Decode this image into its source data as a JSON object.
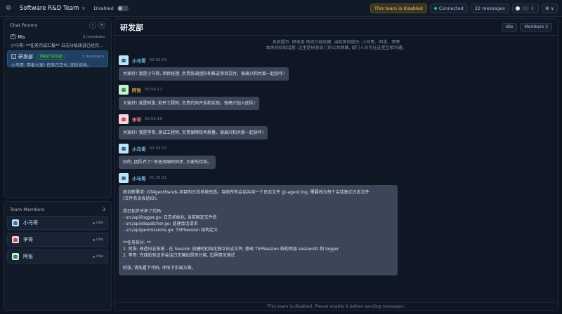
{
  "topbar": {
    "team_name": "Software R&D Team",
    "disabled_label": "Disabled",
    "warn_text": "This team is disabled",
    "connected_text": "Connected",
    "messages_text": "22 messages"
  },
  "rooms": {
    "title": "Chat Rooms",
    "items": [
      {
        "name": "Ma",
        "icon": "P",
        "count": "2 members",
        "preview": "小马哥: **任务完成汇报** 日志分级改进已经完成..."
      },
      {
        "name": "研发部",
        "icon": "□",
        "badge": "Dept Group",
        "count": "3 members",
        "preview": "小马哥: 李麦大家! 任务已交付, 团队待命。"
      }
    ]
  },
  "members": {
    "title": "Team Members",
    "count": "3",
    "items": [
      {
        "name": "小马哥",
        "status": "Idle"
      },
      {
        "name": "李哥",
        "status": "Idle"
      },
      {
        "name": "阿张",
        "status": "Idle"
      }
    ]
  },
  "chat": {
    "title": "研发部",
    "status_btn": "Idle",
    "members_btn": "Members 3",
    "system_line1": "系统提示: 研发部 房间已经创建, 当前房间成员: 小马哥、阿张、李哥",
    "system_line2": "本房间初始话题: 这里是研发部门的公共群聊, 部门人员可在这里互相沟通。",
    "messages": [
      {
        "name": "小马哥",
        "time": "00:56:04",
        "text": "大家好! 我是小马哥, 项目经理, 负责协调团队和推进项目交付。很高兴和大家一起协作!"
      },
      {
        "name": "阿张",
        "time": "00:56:12",
        "text": "大家好! 我是阿张, 软件工程师, 负责代码开发和实现。很高兴加入团队!"
      },
      {
        "name": "李哥",
        "time": "00:56:19",
        "text": "大家好! 我是李哥, 测试工程师, 负责保障软件质量。很高兴和大家一起协作!"
      },
      {
        "name": "小马哥",
        "time": "00:59:27",
        "text": "好的, 团队齐了! 有任务随时同步, 大家先待命。"
      },
      {
        "name": "小马哥",
        "time": "01:30:21",
        "lines": [
          "收到新需求: GTAgentHands 项目的日志系统改造。目前所有会话共用一个日志文件 gt-agent.log, 需要改为每个会话独立日志文件",
          "(文件名含会话ID)。",
          "",
          "我已初步分析了代码:",
          "- src/api/logger.go: 日志初始化, 当前固定文件名",
          "- src/api/dispatcher.go: 处理会话请求",
          "- src/api/permissions.go: TSPSession 结构定义",
          "",
          "**任务拆分: **",
          "1. 阿张: 改造日志系统 - 在 Session 创建时初始化独立日志文件, 修改 TSPSession 结构添加 sessionID 和 logger",
          "2. 李哥: 完成后验证多会话日志输出是否分离, 边界情况测试",
          "",
          "阿张, 请先看下代码, 评估下实现方案。"
        ]
      }
    ]
  },
  "footer_note": "This team is disabled. Please enable it before sending messages.",
  "colors": {
    "name_blue": "#7cc4f5",
    "name_orange": "#e8b04a",
    "name_red": "#f07b7b",
    "accent_green": "#3fb58a"
  }
}
